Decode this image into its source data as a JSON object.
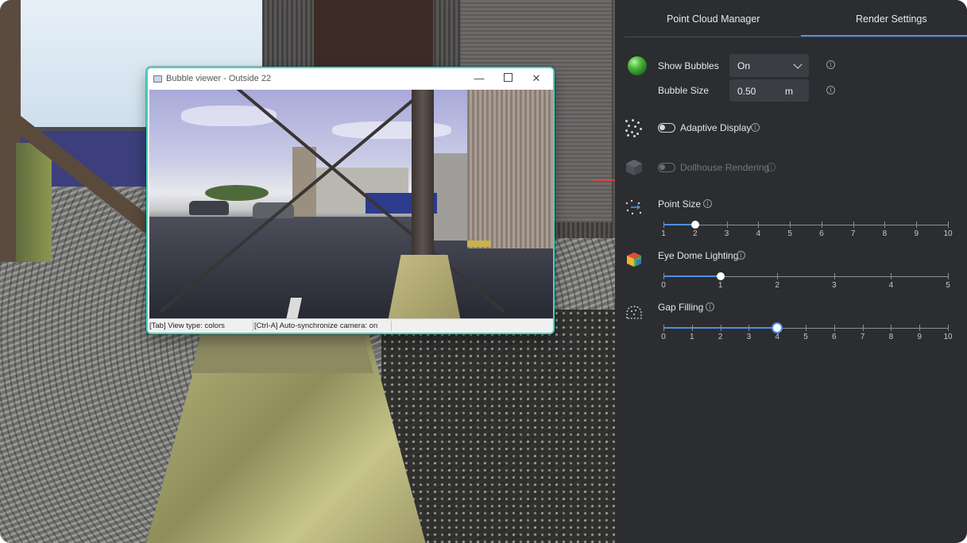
{
  "bubble_viewer": {
    "title": "Bubble viewer - Outside 22",
    "status_view_type": "[Tab] View type: colors",
    "status_sync": "[Ctrl-A] Auto-synchronize camera: on"
  },
  "panel": {
    "tabs": [
      {
        "label": "Point Cloud Manager",
        "active": false
      },
      {
        "label": "Render Settings",
        "active": true
      }
    ],
    "show_bubbles": {
      "label": "Show Bubbles",
      "value": "On"
    },
    "bubble_size": {
      "label": "Bubble Size",
      "value": "0.50",
      "unit": "m"
    },
    "adaptive_display": {
      "label": "Adaptive Display",
      "enabled": false
    },
    "dollhouse_rendering": {
      "label": "Dollhouse Rendering",
      "enabled": false,
      "disabled": true
    },
    "point_size": {
      "label": "Point Size",
      "min": 1,
      "max": 10,
      "value": 2,
      "ticks": [
        "1",
        "2",
        "3",
        "4",
        "5",
        "6",
        "7",
        "8",
        "9",
        "10"
      ]
    },
    "eye_dome_lighting": {
      "label": "Eye Dome Lighting",
      "min": 0,
      "max": 5,
      "value": 1,
      "ticks": [
        "0",
        "1",
        "2",
        "3",
        "4",
        "5"
      ]
    },
    "gap_filling": {
      "label": "Gap Filling",
      "min": 0,
      "max": 10,
      "value": 4,
      "ticks": [
        "0",
        "1",
        "2",
        "3",
        "4",
        "5",
        "6",
        "7",
        "8",
        "9",
        "10"
      ]
    }
  },
  "colors": {
    "accent": "#4d8fe2",
    "panel_bg": "#2b2d31",
    "window_border": "#3ad9c3"
  }
}
